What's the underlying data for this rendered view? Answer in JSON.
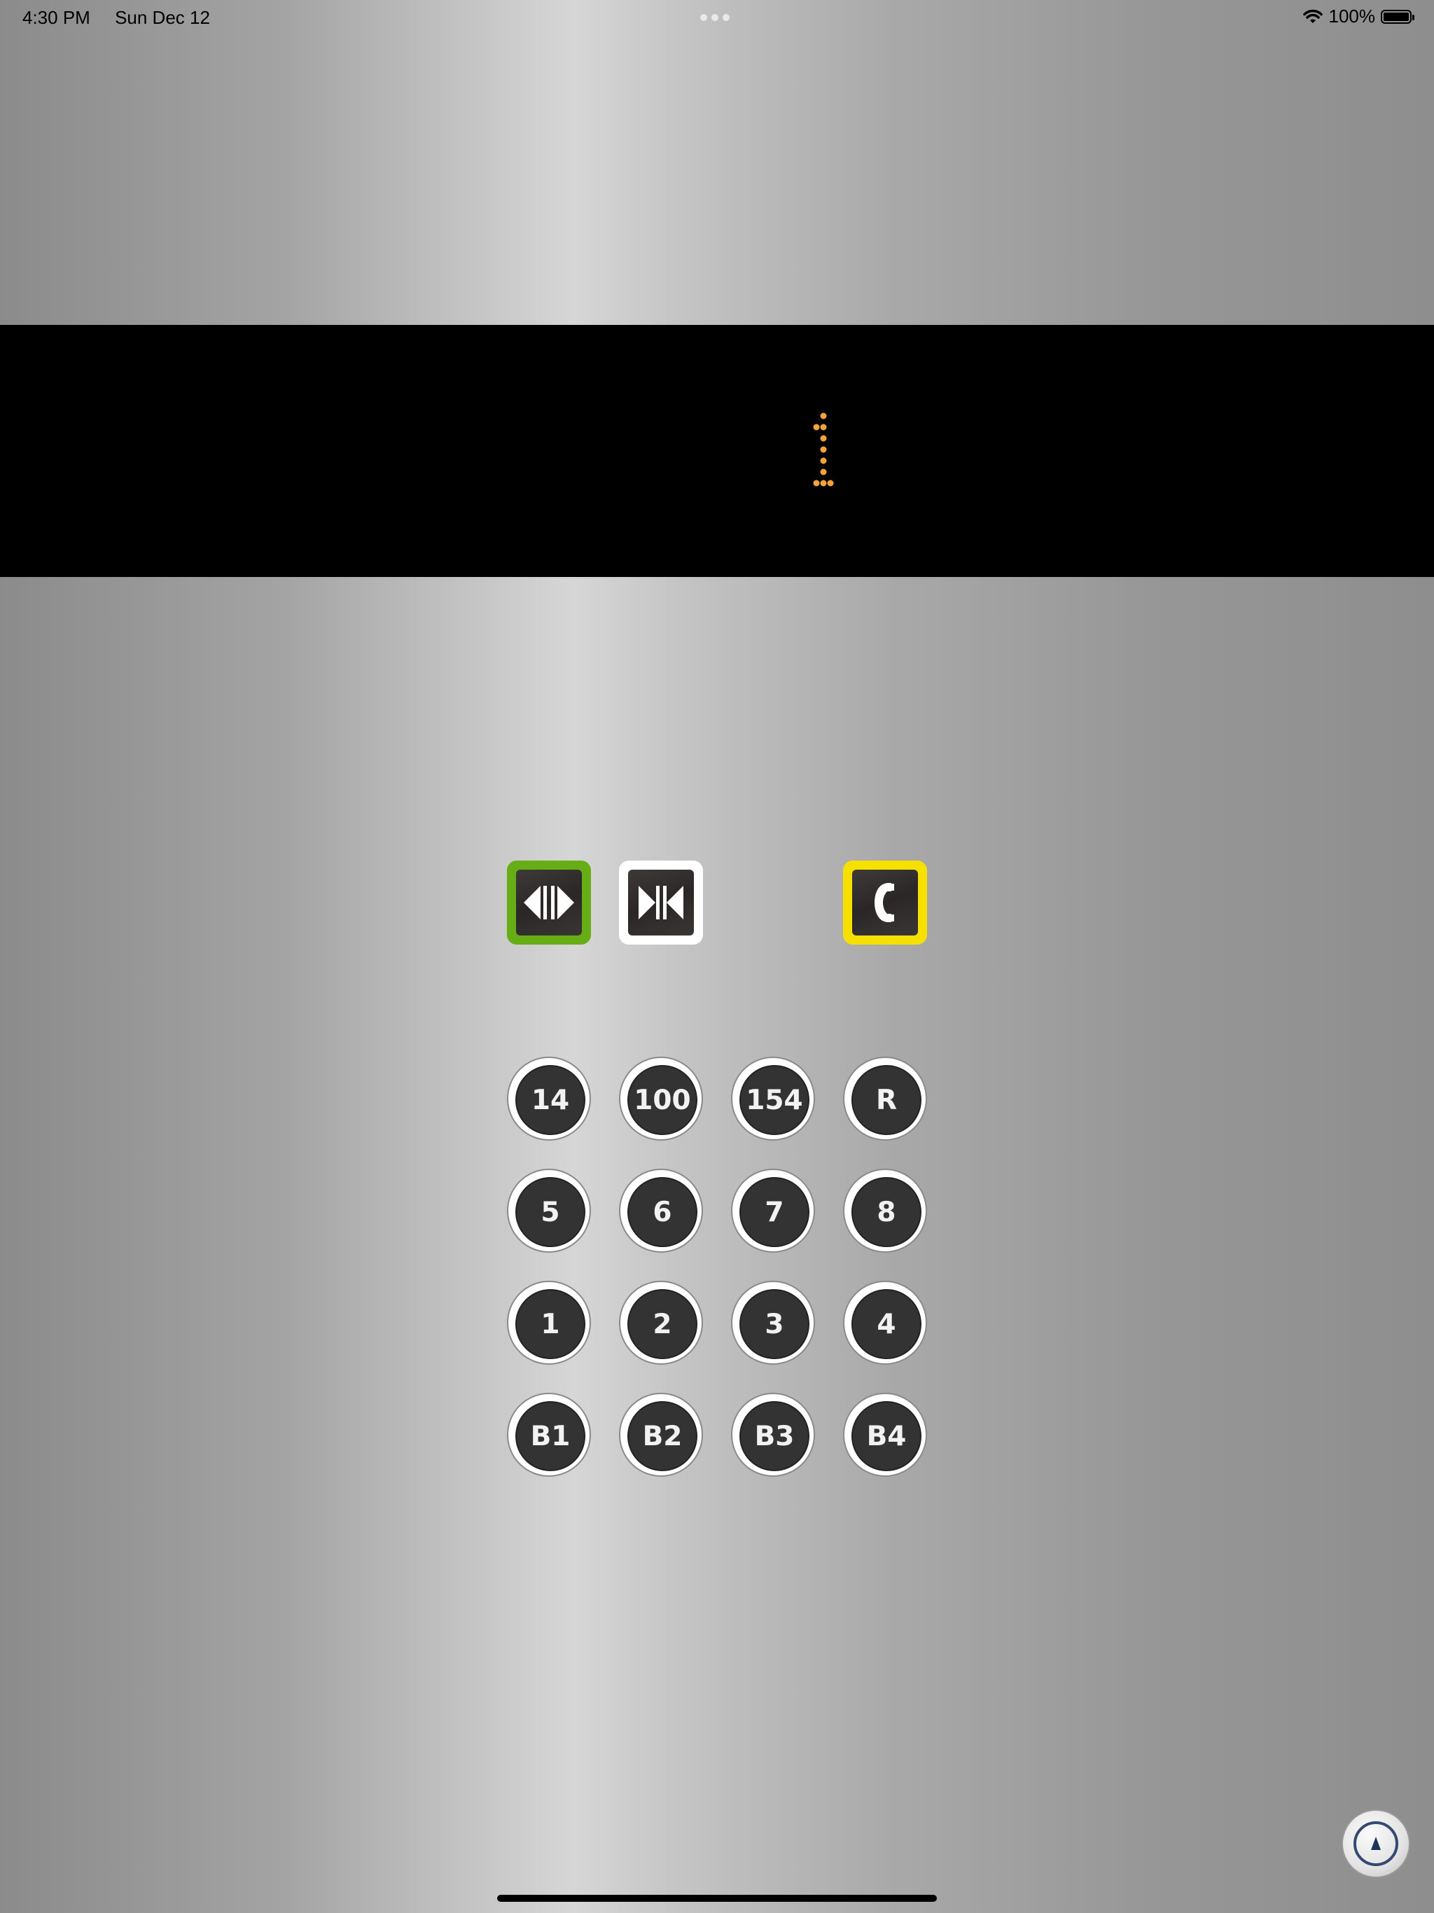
{
  "status_bar": {
    "time": "4:30 PM",
    "date": "Sun Dec 12",
    "battery": "100%",
    "icons": [
      "wifi-icon",
      "battery-icon"
    ]
  },
  "display": {
    "floor": "1",
    "digit_color": "#f5a23a"
  },
  "controls": {
    "open": {
      "icon": "door-open-icon",
      "border_color": "#66ad16"
    },
    "close": {
      "icon": "door-close-icon",
      "border_color": "#ffffff"
    },
    "call": {
      "icon": "phone-icon",
      "border_color": "#f6e000"
    }
  },
  "floor_buttons": [
    [
      "14",
      "100",
      "154",
      "R"
    ],
    [
      "5",
      "6",
      "7",
      "8"
    ],
    [
      "1",
      "2",
      "3",
      "4"
    ],
    [
      "B1",
      "B2",
      "B3",
      "B4"
    ]
  ]
}
